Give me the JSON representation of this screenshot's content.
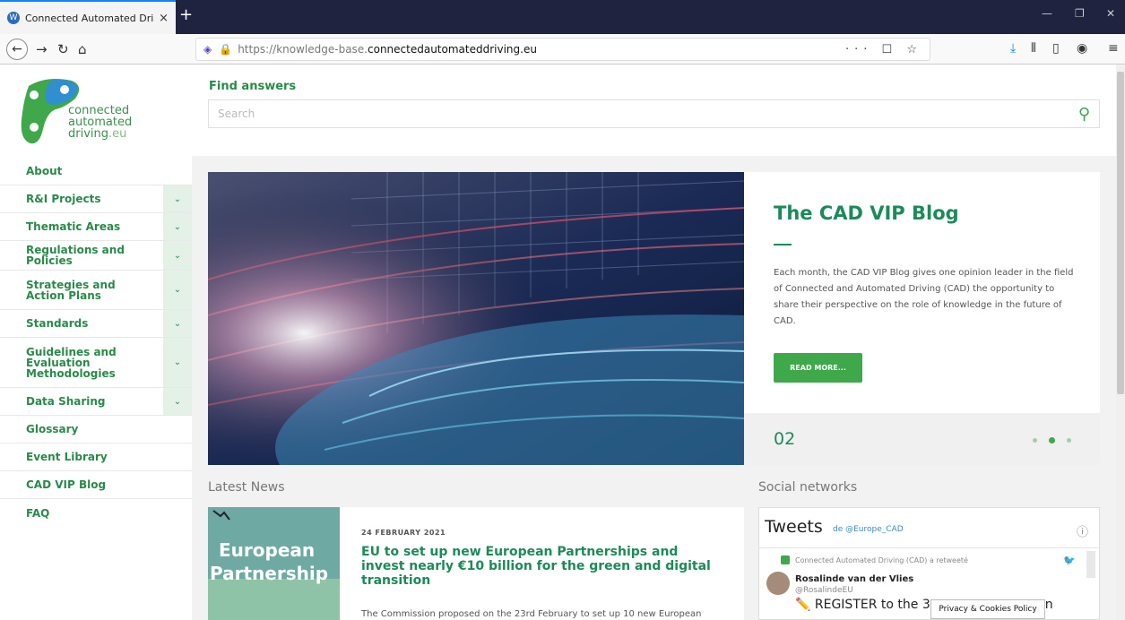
{
  "browser": {
    "tab_title": "Connected Automated Driving",
    "tab_close": "×",
    "new_tab": "+",
    "url_scheme_part": "https://knowledge-base.",
    "url_host_part": "connectedautomateddriving.eu",
    "page_actions": "··· ☐ ☆"
  },
  "logo": {
    "line1": "connected",
    "line2": "automated",
    "line3_main": "driving",
    "line3_suffix": ".eu"
  },
  "sidebar": {
    "items": [
      {
        "label": "About",
        "has_submenu": false
      },
      {
        "label": "R&I Projects",
        "has_submenu": true
      },
      {
        "label": "Thematic Areas",
        "has_submenu": true
      },
      {
        "label": "Regulations and Policies",
        "has_submenu": true
      },
      {
        "label": "Strategies and Action Plans",
        "has_submenu": true
      },
      {
        "label": "Standards",
        "has_submenu": true
      },
      {
        "label": "Guidelines and Evaluation Methodologies",
        "has_submenu": true
      },
      {
        "label": "Data Sharing",
        "has_submenu": true
      },
      {
        "label": "Glossary",
        "has_submenu": false
      },
      {
        "label": "Event Library",
        "has_submenu": false
      },
      {
        "label": "CAD VIP Blog",
        "has_submenu": false
      },
      {
        "label": "FAQ",
        "has_submenu": false
      }
    ]
  },
  "search": {
    "heading": "Find answers",
    "placeholder": "Search"
  },
  "hero": {
    "title": "The CAD VIP Blog",
    "text": "Each month, the CAD VIP Blog gives one opinion leader in the field of Connected and Automated Driving (CAD) the opportunity to share their perspective on the role of knowledge in the future of CAD.",
    "button": "READ MORE...",
    "slide_number": "02",
    "slide_count": 3,
    "active_slide": 1
  },
  "latest_news": {
    "section_title": "Latest News",
    "thumb_line1": "European",
    "thumb_line2": "Partnership",
    "date": "24 FEBRUARY 2021",
    "title": "EU to set up new European Partnerships and invest nearly €10 billion for the green and digital transition",
    "excerpt": "The Commission proposed on the 23rd February to set up 10 new European"
  },
  "social": {
    "section_title": "Social networks",
    "heading": "Tweets",
    "by": "de @Europe_CAD",
    "retweet_note": "Connected Automated Driving (CAD) a retweeté",
    "author_name": "Rosalinde van der Vlies",
    "author_handle": "@RosalindeEU",
    "body": "✏️ REGISTER to the 3",
    "body_end": "n"
  },
  "privacy": {
    "label": "Privacy & Cookies Policy"
  },
  "colors": {
    "brand_green": "#1d8a5a",
    "button_green": "#3fa84a",
    "tab_bar": "#1f2340"
  }
}
